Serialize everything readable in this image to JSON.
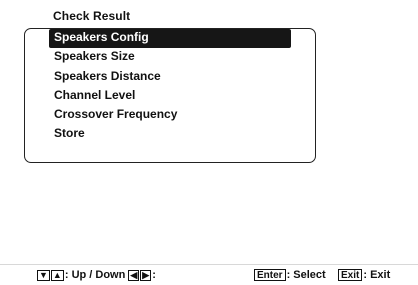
{
  "menu": {
    "header": "Check Result",
    "items": [
      {
        "label": "Speakers Config",
        "selected": true
      },
      {
        "label": "Speakers Size",
        "selected": false
      },
      {
        "label": "Speakers Distance",
        "selected": false
      },
      {
        "label": "Channel Level",
        "selected": false
      },
      {
        "label": "Crossover Frequency",
        "selected": false
      },
      {
        "label": "Store",
        "selected": false
      }
    ]
  },
  "status_bar": {
    "updown_label": ": Up / Down",
    "leftright_label": ":",
    "enter_key": "Enter",
    "enter_label": ": Select",
    "exit_key": "Exit",
    "exit_label": ": Exit"
  },
  "icons": {
    "down": "▼",
    "up": "▲",
    "left": "◀",
    "right": "▶"
  }
}
